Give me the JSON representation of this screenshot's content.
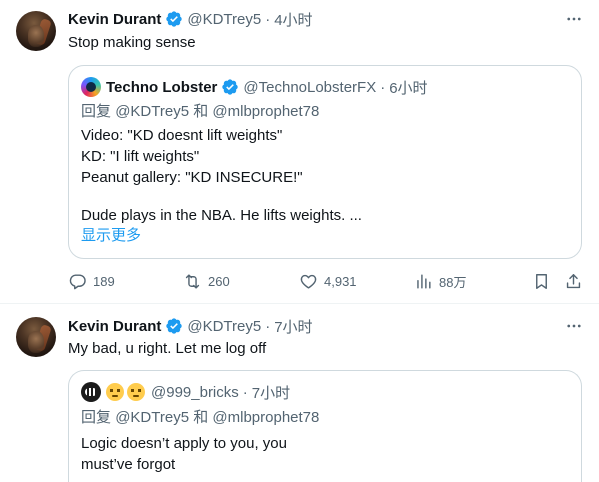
{
  "tweet1": {
    "author_name": "Kevin Durant",
    "handle": "@KDTrey5",
    "time": "4小时",
    "text": "Stop making sense",
    "quote": {
      "author_name": "Techno Lobster",
      "handle": "@TechnoLobsterFX",
      "time": "6小时",
      "reply_prefix": "回复",
      "reply_mention_1": "@KDTrey5",
      "reply_and": "和",
      "reply_mention_2": "@mlbprophet78",
      "lines": [
        "Video: \"KD doesnt lift weights\"",
        "KD: \"I lift weights\"",
        "Peanut gallery: \"KD INSECURE!\"",
        "Dude plays in the NBA. He lifts weights. ..."
      ],
      "show_more": "显示更多"
    },
    "actions": {
      "replies": "189",
      "retweets": "260",
      "likes": "4,931",
      "views": "88万"
    }
  },
  "tweet2": {
    "author_name": "Kevin Durant",
    "handle": "@KDTrey5",
    "time": "7小时",
    "text": "My bad, u right. Let me log off",
    "quote": {
      "handle": "@999_bricks",
      "time": "7小时",
      "reply_prefix": "回复",
      "reply_mention_1": "@KDTrey5",
      "reply_and": "和",
      "reply_mention_2": "@mlbprophet78",
      "lines": [
        "Logic doesn’t apply to you, you",
        "must’ve forgot"
      ]
    }
  },
  "colors": {
    "text": "#0f1419",
    "muted": "#536471",
    "accent": "#1d9bf0",
    "border": "#cfd9de"
  },
  "icons": [
    "verified-badge-icon",
    "more-icon",
    "reply-icon",
    "retweet-icon",
    "like-icon",
    "views-icon",
    "bookmark-icon",
    "share-icon"
  ]
}
